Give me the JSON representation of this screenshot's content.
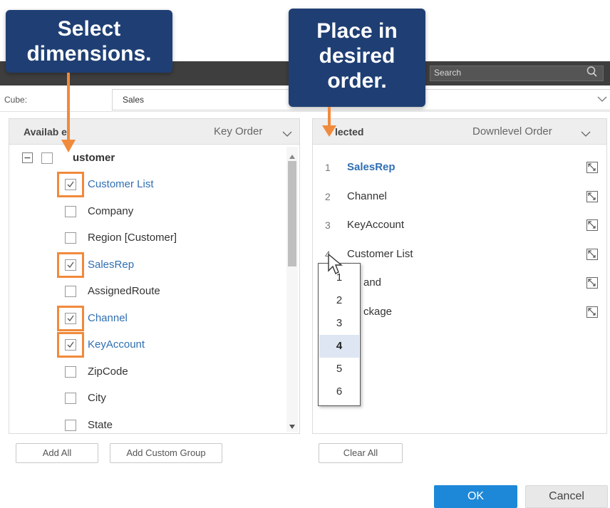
{
  "callouts": {
    "left": [
      "Select",
      "dimensions."
    ],
    "right": [
      "Place in",
      "desired",
      "order."
    ]
  },
  "search": {
    "placeholder": "Search"
  },
  "cube": {
    "label": "Cube:",
    "value": "Sales"
  },
  "available": {
    "title": "Availab e",
    "order": "Key Order",
    "root": "ustomer",
    "items": [
      {
        "label": "Customer List",
        "checked": true
      },
      {
        "label": "Company",
        "checked": false
      },
      {
        "label": "Region [Customer]",
        "checked": false
      },
      {
        "label": "SalesRep",
        "checked": true
      },
      {
        "label": "AssignedRoute",
        "checked": false
      },
      {
        "label": "Channel",
        "checked": true
      },
      {
        "label": "KeyAccount",
        "checked": true
      },
      {
        "label": "ZipCode",
        "checked": false
      },
      {
        "label": "City",
        "checked": false
      },
      {
        "label": "State",
        "checked": false
      }
    ],
    "add_all": "Add All",
    "add_custom_group": "Add Custom Group"
  },
  "selected": {
    "title": "lected",
    "order": "Downlevel Order",
    "items": [
      {
        "num": "1",
        "label": "SalesRep"
      },
      {
        "num": "2",
        "label": "Channel"
      },
      {
        "num": "3",
        "label": "KeyAccount"
      },
      {
        "num": "4",
        "label": "Customer List"
      },
      {
        "num": "",
        "label": "and"
      },
      {
        "num": "",
        "label": "ckage"
      }
    ],
    "clear_all": "Clear All"
  },
  "order_dropdown": {
    "options": [
      "1",
      "2",
      "3",
      "4",
      "5",
      "6"
    ],
    "selected": "4"
  },
  "footer": {
    "ok": "OK",
    "cancel": "Cancel"
  },
  "colors": {
    "accent": "#1e88d8",
    "highlight": "#f08a3c",
    "callout": "#1f3f74",
    "link": "#2f6fb2"
  }
}
